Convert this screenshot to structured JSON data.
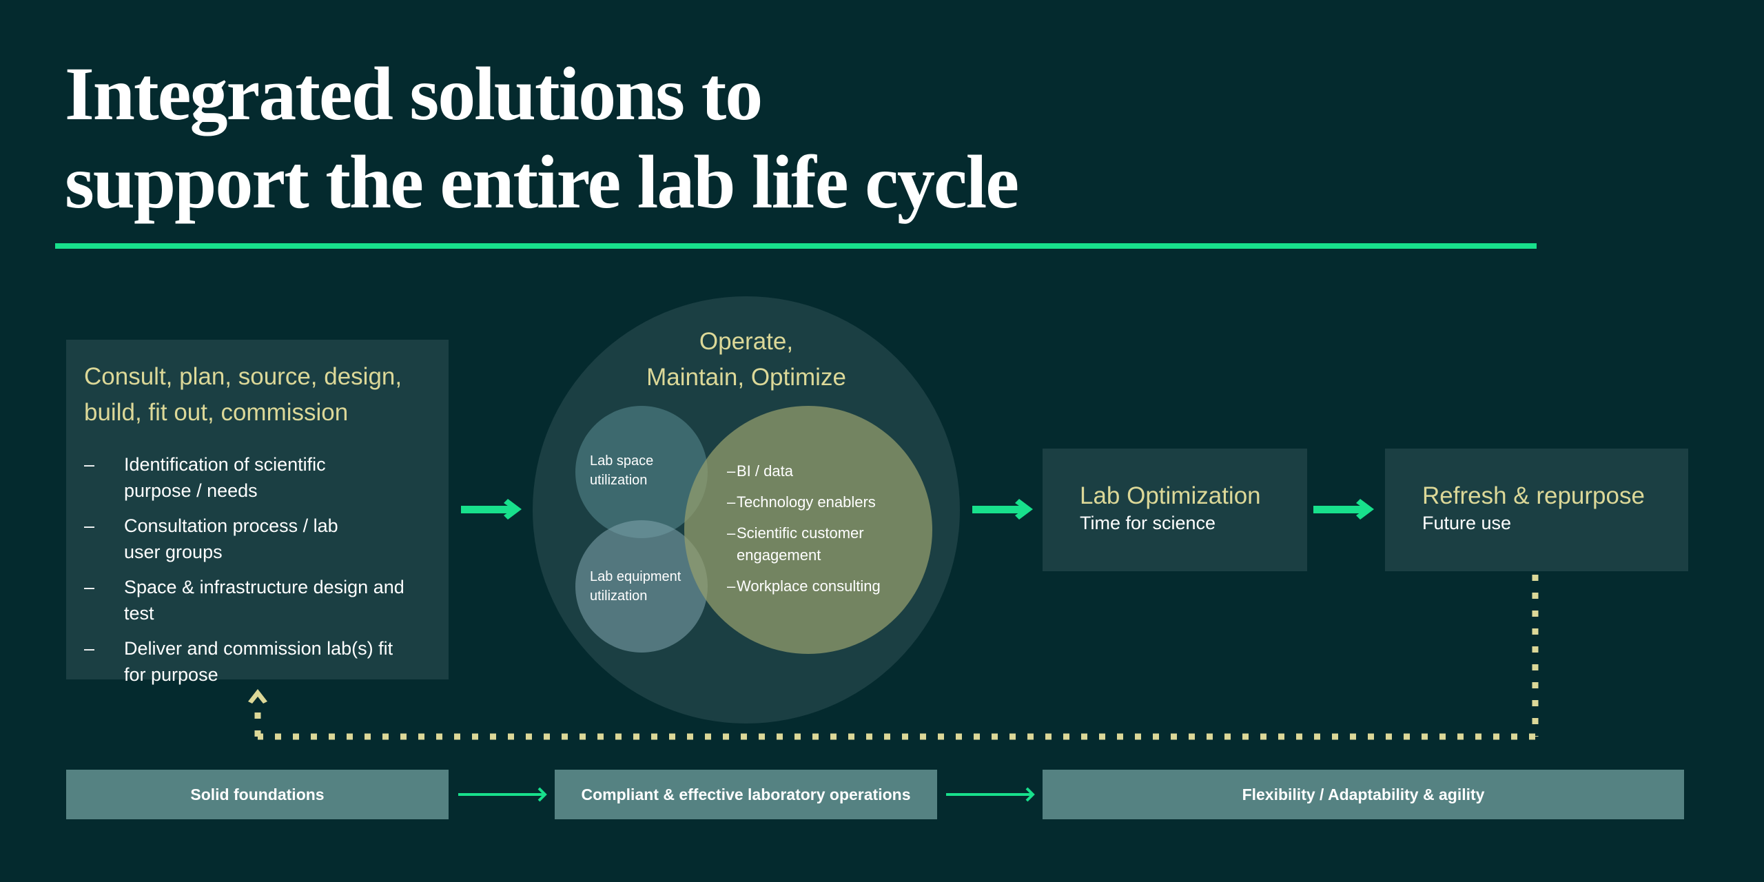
{
  "title": {
    "line1": "Integrated solutions to",
    "line2": "support the entire lab life cycle"
  },
  "colors": {
    "background": "#042a2e",
    "accent_green": "#18e08c",
    "accent_yellow": "#dcd898",
    "panel": "#1b3f43",
    "bar": "#558282"
  },
  "consult": {
    "heading_line1": "Consult, plan, source, design,",
    "heading_line2": "build, fit out, commission",
    "bullets": [
      {
        "dash": "–",
        "line1": "Identification of scientific",
        "line2": "purpose / needs"
      },
      {
        "dash": "–",
        "line1": "Consultation process / lab",
        "line2": "user groups"
      },
      {
        "dash": "–",
        "line1": "Space & infrastructure design and test",
        "line2": ""
      },
      {
        "dash": "–",
        "line1": "Deliver and commission lab(s) fit",
        "line2": "for purpose"
      }
    ]
  },
  "operate": {
    "heading_line1": "Operate,",
    "heading_line2": "Maintain, Optimize",
    "lab_space": {
      "line1": "Lab space",
      "line2": "utilization"
    },
    "lab_equipment": {
      "line1": "Lab equipment",
      "line2": "utilization"
    },
    "items": [
      {
        "dash": "–",
        "line1": "BI / data",
        "line2": ""
      },
      {
        "dash": "–",
        "line1": "Technology enablers",
        "line2": ""
      },
      {
        "dash": "–",
        "line1": "Scientific customer",
        "line2": "engagement"
      },
      {
        "dash": "–",
        "line1": "Workplace consulting",
        "line2": ""
      }
    ]
  },
  "optimization": {
    "title": "Lab Optimization",
    "subtitle": "Time for science"
  },
  "refresh": {
    "title": "Refresh & repurpose",
    "subtitle": "Future use"
  },
  "bottom_bars": [
    {
      "label": "Solid foundations"
    },
    {
      "label": "Compliant & effective laboratory operations"
    },
    {
      "label": "Flexibility / Adaptability & agility"
    }
  ],
  "icons": {
    "flow_arrow": "arrow-right",
    "return_arrow": "chevron-up"
  }
}
